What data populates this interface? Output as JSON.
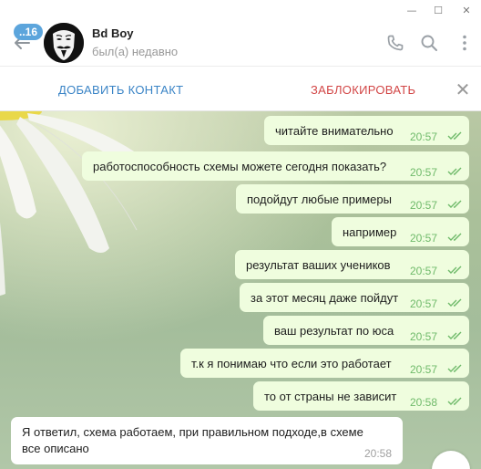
{
  "window": {
    "minimize_glyph": "—",
    "maximize_glyph": "☐",
    "close_glyph": "✕"
  },
  "header": {
    "back_icon": "arrow-left-icon",
    "unread_count": "..16",
    "contact_name": "Bd Boy",
    "contact_status": "был(а) недавно",
    "icons": [
      "phone-icon",
      "search-icon",
      "more-vertical-icon"
    ]
  },
  "actionbar": {
    "add_contact": "ДОБАВИТЬ КОНТАКТ",
    "block": "ЗАБЛОКИРОВАТЬ",
    "close_glyph": "✕"
  },
  "messages": [
    {
      "text": "читайте внимательно",
      "time": "20:57",
      "outgoing": true,
      "read": true
    },
    {
      "text": "работоспособность схемы можете сегодня показать?",
      "time": "20:57",
      "outgoing": true,
      "read": true
    },
    {
      "text": "подойдут любые примеры",
      "time": "20:57",
      "outgoing": true,
      "read": true
    },
    {
      "text": "например",
      "time": "20:57",
      "outgoing": true,
      "read": true
    },
    {
      "text": "результат ваших учеников",
      "time": "20:57",
      "outgoing": true,
      "read": true
    },
    {
      "text": "за этот месяц даже пойдут",
      "time": "20:57",
      "outgoing": true,
      "read": true
    },
    {
      "text": "ваш результат по юса",
      "time": "20:57",
      "outgoing": true,
      "read": true
    },
    {
      "text": "т.к я понимаю что если это работает",
      "time": "20:57",
      "outgoing": true,
      "read": true
    },
    {
      "text": "то от страны не зависит",
      "time": "20:58",
      "outgoing": true,
      "read": true
    },
    {
      "text_line1": "Я ответил, схема работаем, при правильном подходе,в схеме",
      "text_line2": "все описано",
      "time": "20:58",
      "outgoing": false
    }
  ],
  "colors": {
    "accent": "#3a84c6",
    "danger": "#d24646",
    "outgoing_bubble": "#effdde",
    "read_tick": "#6fba6a",
    "badge": "#5ca5dc"
  }
}
